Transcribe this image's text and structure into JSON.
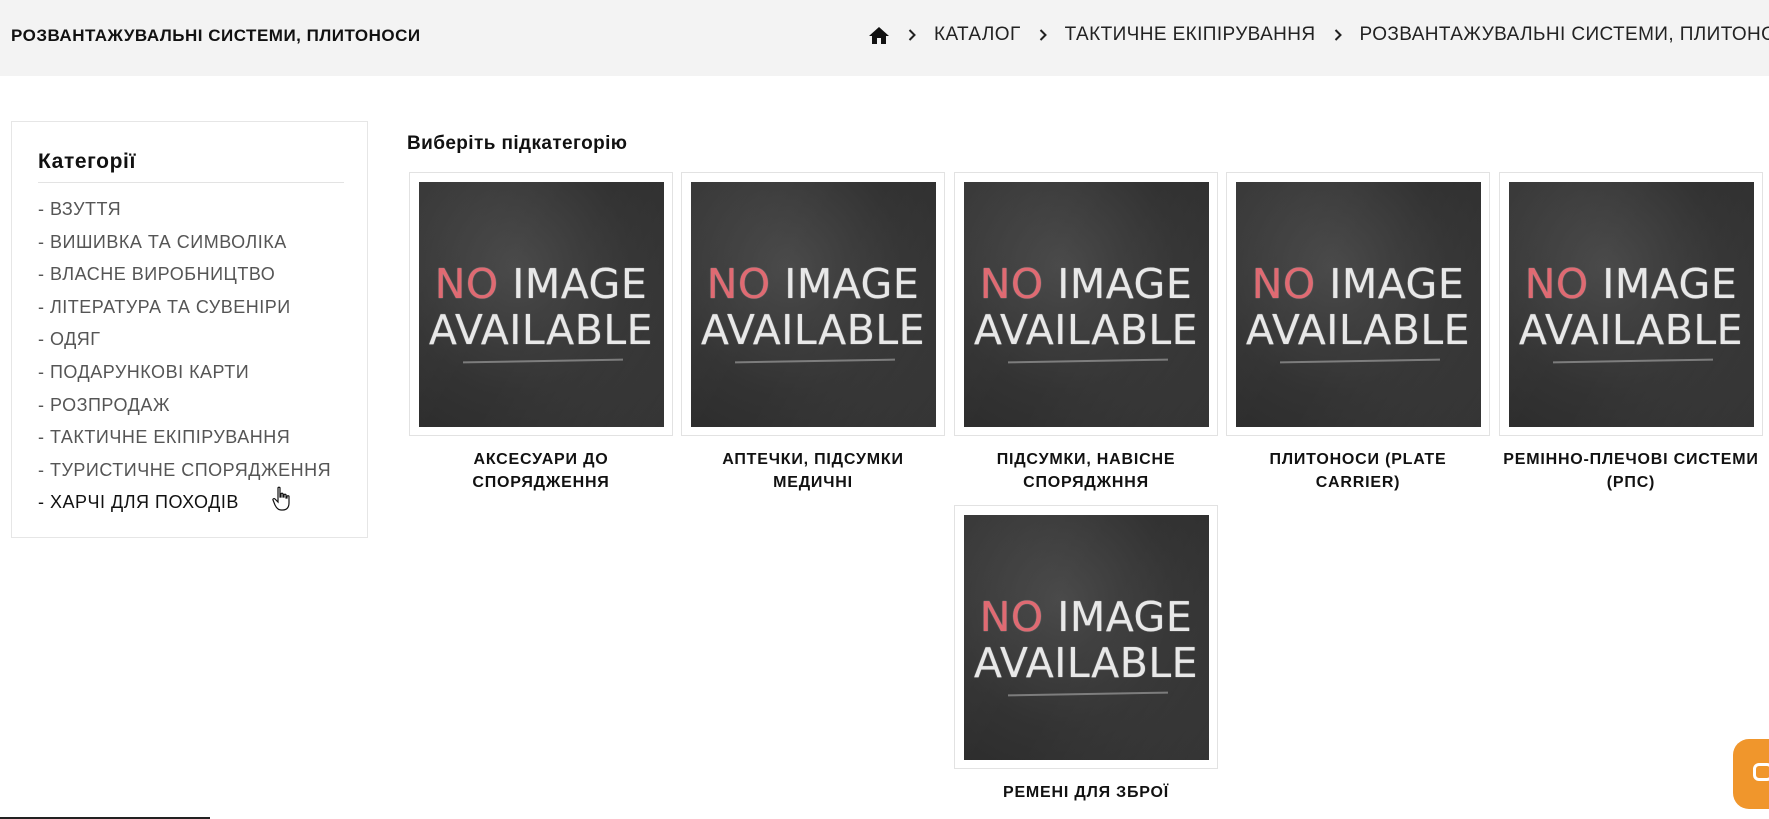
{
  "header": {
    "page_title": "РОЗВАНТАЖУВАЛЬНІ СИСТЕМИ, ПЛИТОНОСИ",
    "breadcrumb": [
      {
        "label": "КАТАЛОГ"
      },
      {
        "label": "ТАКТИЧНЕ ЕКІПІРУВАННЯ"
      },
      {
        "label": "РОЗВАНТАЖУВАЛЬНІ СИСТЕМИ, ПЛИТОНОСИ"
      }
    ],
    "home_icon": "home-icon",
    "separator_icon": "chevron-right-icon"
  },
  "sidebar": {
    "title": "Категорії",
    "items": [
      {
        "label": "- ВЗУТТЯ"
      },
      {
        "label": "- ВИШИВКА ТА СИМВОЛІКА"
      },
      {
        "label": "- ВЛАСНЕ ВИРОБНИЦТВО"
      },
      {
        "label": "- ЛІТЕРАТУРА ТА СУВЕНІРИ"
      },
      {
        "label": "- ОДЯГ"
      },
      {
        "label": "- ПОДАРУНКОВІ КАРТИ"
      },
      {
        "label": "- РОЗПРОДАЖ"
      },
      {
        "label": "- ТАКТИЧНЕ ЕКІПІРУВАННЯ"
      },
      {
        "label": "- ТУРИСТИЧНЕ СПОРЯДЖЕННЯ"
      },
      {
        "label": "- ХАРЧІ ДЛЯ ПОХОДІВ"
      }
    ]
  },
  "main": {
    "heading": "Виберіть підкатегорію",
    "placeholder_image": {
      "word_no": "NO",
      "word_image": "IMAGE",
      "line2": "AVAILABLE"
    },
    "subcategories": [
      {
        "name": "АКСЕСУАРИ ДО СПОРЯДЖЕННЯ"
      },
      {
        "name": "АПТЕЧКИ, ПІДСУМКИ МЕДИЧНІ"
      },
      {
        "name": "ПІДСУМКИ, НАВІСНЕ СПОРЯДЖННЯ"
      },
      {
        "name": "ПЛИТОНОСИ (PLATE CARRIER)"
      },
      {
        "name": "РЕМІННО-ПЛЕЧОВІ СИСТЕМИ (РПС)"
      },
      {
        "name": "РЕМЕНІ ДЛЯ ЗБРОЇ"
      }
    ]
  },
  "colors": {
    "header_bg": "#f3f3f3",
    "no_red": "#e06a72",
    "chat_orange": "#f0962c"
  },
  "widgets": {
    "chat_icon": "chat-icon",
    "cursor_icon": "hand-pointer-icon"
  }
}
